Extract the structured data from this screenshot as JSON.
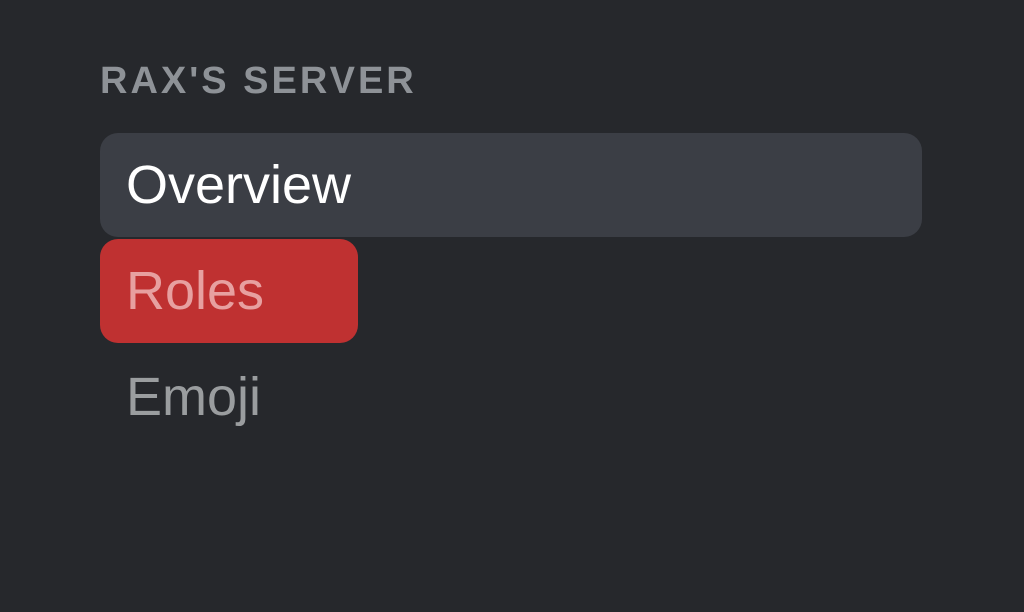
{
  "sidebar": {
    "header": "RAX'S SERVER",
    "items": [
      {
        "label": "Overview"
      },
      {
        "label": "Roles"
      },
      {
        "label": "Emoji"
      }
    ]
  }
}
